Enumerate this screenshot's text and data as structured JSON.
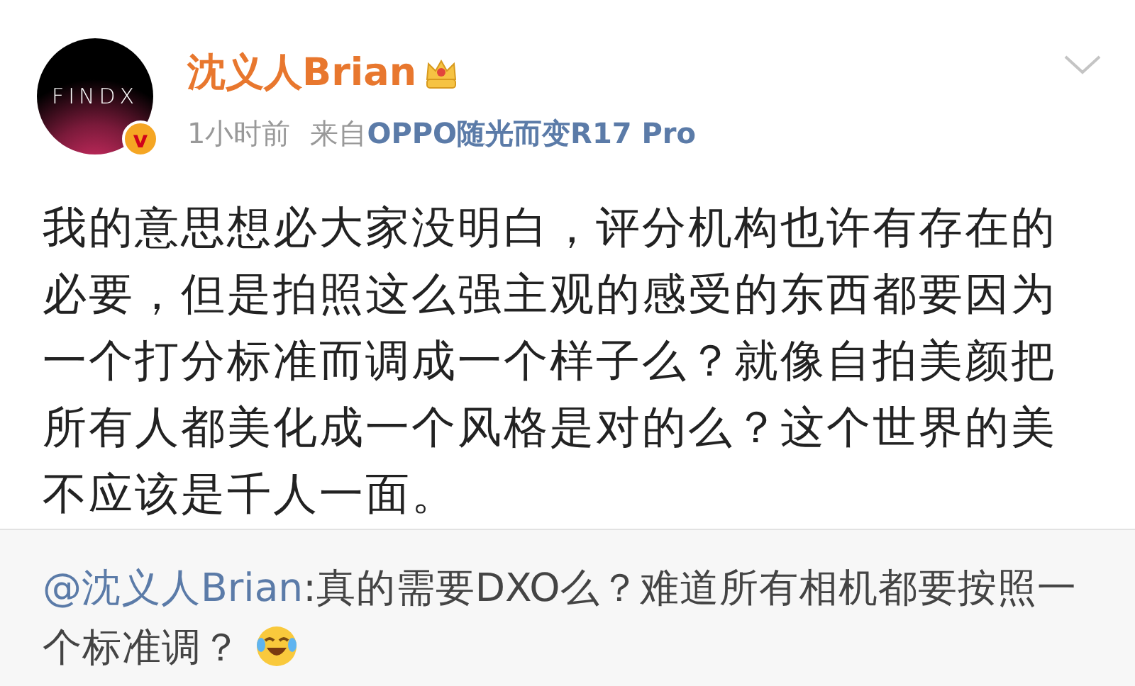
{
  "author": {
    "avatar_logo": "FINDX",
    "badge": "v",
    "name": "沈义人Brian"
  },
  "meta": {
    "time": "1小时前",
    "source_prefix": "来自",
    "source": "OPPO随光而变R17 Pro"
  },
  "body": "我的意思想必大家没明白，评分机构也许有存在的必要，但是拍照这么强主观的感受的东西都要因为一个打分标准而调成一个样子么？就像自拍美颜把所有人都美化成一个风格是对的么？这个世界的美不应该是千人一面。",
  "repost": {
    "mention": "@沈义人Brian",
    "text": ":真的需要DXO么？难道所有相机都要按照一个标准调？"
  }
}
